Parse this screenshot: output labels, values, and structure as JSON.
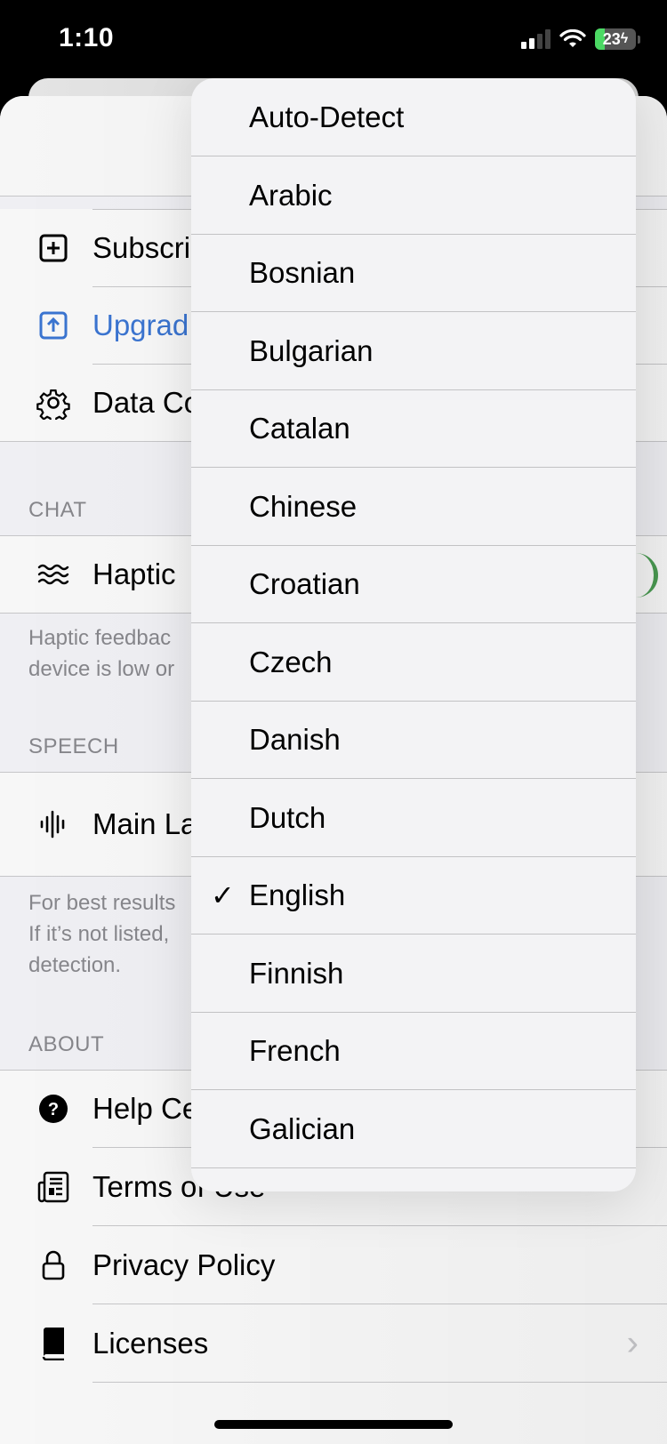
{
  "status_bar": {
    "time": "1:10",
    "battery_level": "23",
    "battery_percent": 23,
    "charging": true,
    "signal_bars": 2,
    "signal_bars_total": 4
  },
  "settings": {
    "account_rows": [
      {
        "label": "Subscription",
        "visible_label": "Subscri",
        "icon": "plus-square-icon"
      },
      {
        "label": "Upgrade",
        "visible_label": "Upgrad",
        "icon": "arrow-up-square-icon"
      },
      {
        "label": "Data Controls",
        "visible_label": "Data Co",
        "icon": "gear-icon"
      }
    ],
    "chat": {
      "header": "CHAT",
      "haptic_label": "Haptic",
      "haptic_enabled": true,
      "footnote": "Haptic feedbac\ndevice is low or"
    },
    "speech": {
      "header": "SPEECH",
      "main_language_label": "Main La",
      "footnote": "For best results\nIf it’s not listed,\ndetection."
    },
    "about": {
      "header": "ABOUT",
      "rows": [
        {
          "label": "Help Ce",
          "icon": "question-circle-icon"
        },
        {
          "label": "Terms of Use",
          "icon": "newspaper-icon"
        },
        {
          "label": "Privacy Policy",
          "icon": "lock-icon"
        },
        {
          "label": "Licenses",
          "icon": "book-icon",
          "chevron": "›"
        }
      ]
    }
  },
  "language_menu": {
    "selected": "English",
    "check_glyph": "✓",
    "items": [
      "Auto-Detect",
      "Arabic",
      "Bosnian",
      "Bulgarian",
      "Catalan",
      "Chinese",
      "Croatian",
      "Czech",
      "Danish",
      "Dutch",
      "English",
      "Finnish",
      "French",
      "Galician"
    ]
  },
  "colors": {
    "accent_blue": "#3a74d0",
    "toggle_green": "#4a9b52",
    "battery_green": "#4cd964"
  }
}
